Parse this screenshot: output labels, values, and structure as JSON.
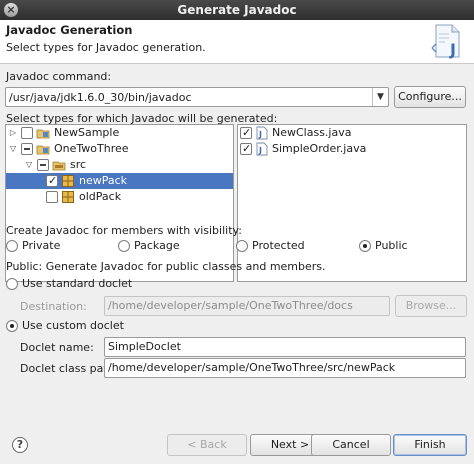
{
  "window": {
    "title": "Generate Javadoc"
  },
  "header": {
    "title": "Javadoc Generation",
    "description": "Select types for Javadoc generation."
  },
  "command": {
    "label": "Javadoc command:",
    "value": "/usr/java/jdk1.6.0_30/bin/javadoc",
    "configure_label": "Configure..."
  },
  "types_label": "Select types for which Javadoc will be generated:",
  "tree": [
    {
      "label": "NewSample",
      "twisty": "▷",
      "check": "unchecked",
      "icon": "project-icon"
    },
    {
      "label": "OneTwoThree",
      "twisty": "▽",
      "check": "partial",
      "icon": "project-icon"
    },
    {
      "label": "src",
      "twisty": "▽",
      "check": "partial",
      "icon": "source-folder-icon"
    },
    {
      "label": "newPack",
      "twisty": "",
      "check": "checked",
      "icon": "package-icon",
      "selected": true
    },
    {
      "label": "oldPack",
      "twisty": "",
      "check": "unchecked",
      "icon": "package-icon"
    }
  ],
  "files": [
    {
      "label": "NewClass.java",
      "check": "checked",
      "icon": "java-file-icon"
    },
    {
      "label": "SimpleOrder.java",
      "check": "checked",
      "icon": "java-file-icon"
    }
  ],
  "visibility": {
    "label": "Create Javadoc for members with visibility:",
    "options": [
      "Private",
      "Package",
      "Protected",
      "Public"
    ],
    "selected": "Public",
    "note": "Public: Generate Javadoc for public classes and members."
  },
  "standard_doclet": {
    "label": "Use standard doclet",
    "destination_label": "Destination:",
    "destination_value": "/home/developer/sample/OneTwoThree/docs",
    "browse_label": "Browse..."
  },
  "custom_doclet": {
    "label": "Use custom doclet",
    "name_label": "Doclet name:",
    "name_value": "SimpleDoclet",
    "path_label": "Doclet class path:",
    "path_value": "/home/developer/sample/OneTwoThree/src/newPack"
  },
  "footer": {
    "help": "?",
    "back_label": "< Back",
    "next_label": "Next >",
    "cancel_label": "Cancel",
    "finish_label": "Finish"
  }
}
